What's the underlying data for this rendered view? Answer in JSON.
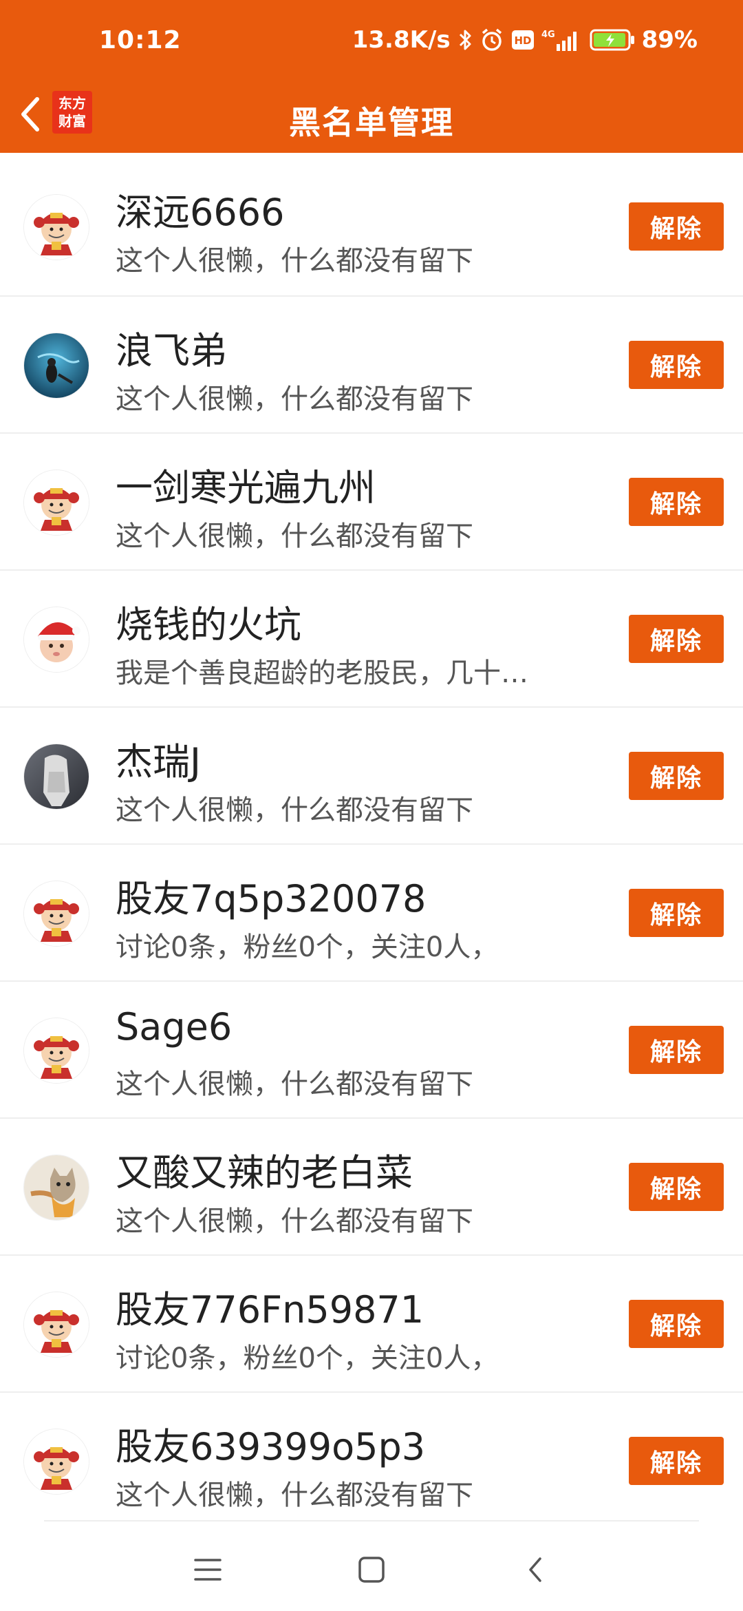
{
  "status_bar": {
    "time": "10:12",
    "net_speed": "13.8K/s",
    "network": "4G",
    "battery": "89%"
  },
  "nav": {
    "title": "黑名单管理",
    "logo_line1": "东方",
    "logo_line2": "财富"
  },
  "blacklist": [
    {
      "name": "深远6666",
      "desc": "这个人很懒，什么都没有留下",
      "button": "解除",
      "avatar": "caishen-avatar"
    },
    {
      "name": "浪飞弟",
      "desc": "这个人很懒，什么都没有留下",
      "button": "解除",
      "avatar": "diver-avatar"
    },
    {
      "name": "一剑寒光遍九州",
      "desc": "这个人很懒，什么都没有留下",
      "button": "解除",
      "avatar": "caishen-avatar"
    },
    {
      "name": "烧钱的火坑",
      "desc": "我是个善良超龄的老股民，几十…",
      "button": "解除",
      "avatar": "santa-baby-avatar"
    },
    {
      "name": "杰瑞J",
      "desc": "这个人很懒，什么都没有留下",
      "button": "解除",
      "avatar": "figure-avatar"
    },
    {
      "name": "股友7q5p320078",
      "desc": "讨论0条，粉丝0个，关注0人，",
      "button": "解除",
      "avatar": "caishen-avatar"
    },
    {
      "name": "Sage6",
      "desc": "这个人很懒，什么都没有留下",
      "button": "解除",
      "avatar": "caishen-avatar"
    },
    {
      "name": "又酸又辣的老白菜",
      "desc": "这个人很懒，什么都没有留下",
      "button": "解除",
      "avatar": "cat-avatar"
    },
    {
      "name": "股友776Fn59871",
      "desc": "讨论0条，粉丝0个，关注0人，",
      "button": "解除",
      "avatar": "caishen-avatar"
    },
    {
      "name": "股友639399o5p3",
      "desc": "这个人很懒，什么都没有留下",
      "button": "解除",
      "avatar": "caishen-avatar"
    }
  ],
  "colors": {
    "accent": "#e85a0d",
    "logo_red": "#e8321a"
  },
  "icons": {
    "back": "chevron-left-icon",
    "menu": "menu-icon",
    "home": "home-square-icon",
    "sys_back": "back-triangle-icon"
  }
}
